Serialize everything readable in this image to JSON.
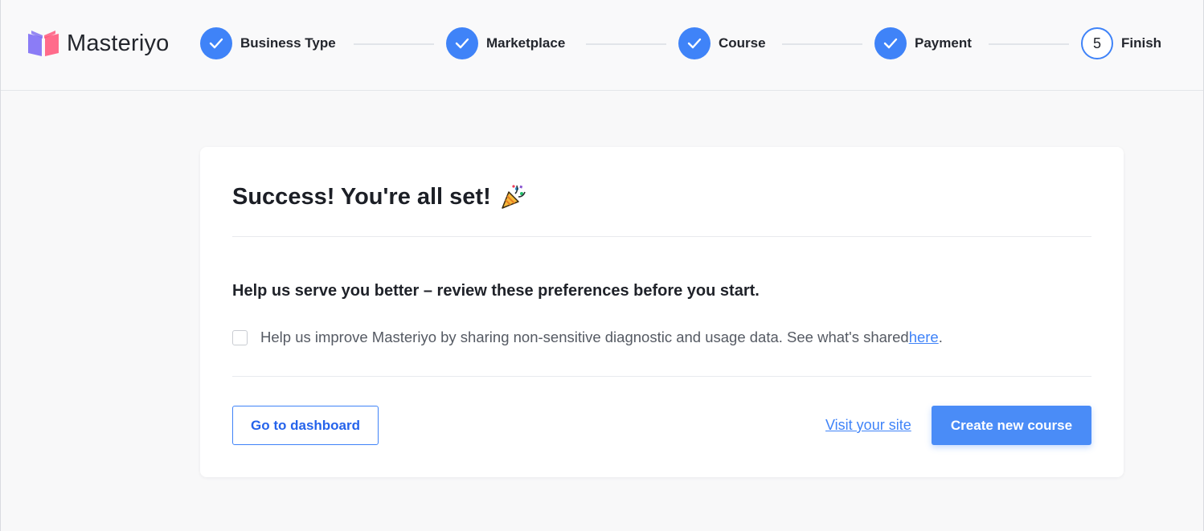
{
  "app": {
    "name": "Masteriyo"
  },
  "stepper": {
    "steps": [
      {
        "label": "Business Type",
        "state": "complete"
      },
      {
        "label": "Marketplace",
        "state": "complete"
      },
      {
        "label": "Course",
        "state": "complete"
      },
      {
        "label": "Payment",
        "state": "complete"
      },
      {
        "label": "Finish",
        "state": "current",
        "number": "5"
      }
    ]
  },
  "card": {
    "title": "Success! You're all set!",
    "title_icon": "party-popper-icon",
    "subtitle": "Help us serve you better – review these preferences before you start.",
    "consent": {
      "checked": false,
      "text": "Help us improve Masteriyo by sharing non-sensitive diagnostic and usage data. See what's shared ",
      "link_text": "here",
      "suffix": "."
    },
    "buttons": {
      "dashboard": "Go to dashboard",
      "visit_site": "Visit your site",
      "create_course": "Create new course"
    }
  },
  "colors": {
    "accent": "#3f83f8",
    "background": "#f8f8f9",
    "card": "#ffffff"
  }
}
